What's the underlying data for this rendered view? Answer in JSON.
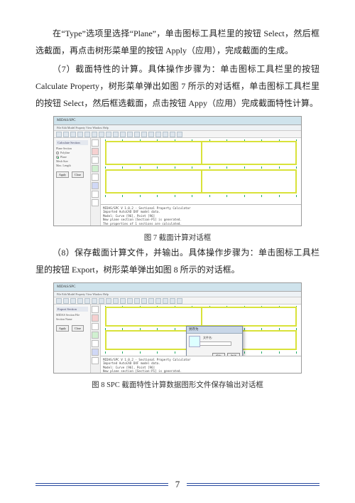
{
  "paragraphs": {
    "p1": "在“Type”选项里选择“Plane”，单击图标工具栏里的按钮 Select，然后框选截面，再点击树形菜单里的按钮 Apply（应用），完成截面的生成。",
    "p2": "（7）截面特性的计算。具体操作步骤为：单击图标工具栏里的按钮 Calculate Property，树形菜单弹出如图 7 所示的对话框，单击图标工具栏里的按钮 Select，然后框选截面，点击按钮 Appy（应用）完成截面特性计算。",
    "p3": "（8）保存截面计算文件，并输出。具体操作步骤为：单击图标工具栏里的按钮 Export，树形菜单弹出如图 8 所示的对话框。"
  },
  "fig7": {
    "caption": "图 7 截面计算对话框",
    "window_title": "MIDAS/SPC",
    "menu": "File  Edit  Model  Property  View  Window  Help",
    "side": {
      "panel_title": "Calculate Section",
      "group1": "Plane Section",
      "opt1": "Polyline",
      "opt2": "Plane",
      "group2": "Mesh Size",
      "mesh_label": "Max. Length",
      "btn_apply": "Apply",
      "btn_close": "Close"
    },
    "log": {
      "l1": "MIDAS/SPC V 1.0.2 - Sectional Property Calculator",
      "l2": "Imported AutoCAD DXF model data.",
      "l3": "Model: Curve [96], Point [96]",
      "l4": "New plane section [Section-P1] is generated.",
      "l5": "The properties of 1 sections are calculated."
    }
  },
  "fig8": {
    "caption": "图 8 SPC 截面特性计算数据图形文件保存输出对话框",
    "window_title": "MIDAS/SPC",
    "menu": "File  Edit  Model  Property  View  Window  Help",
    "side": {
      "panel_title": "Export Section",
      "label1": "MIDAS Section File",
      "label2": "Section Name",
      "btn_apply": "Apply",
      "btn_close": "Close"
    },
    "dialog": {
      "title": "另存为",
      "label": "文件名:",
      "btn_save": "保存",
      "btn_cancel": "取消"
    },
    "log": {
      "l1": "MIDAS/SPC V 1.0.2 - Sectional Property Calculator",
      "l2": "Imported AutoCAD DXF model data.",
      "l3": "Model: Curve [96], Point [96]",
      "l4": "New plane section [Section-P1] is generated."
    }
  },
  "page_number": "7"
}
